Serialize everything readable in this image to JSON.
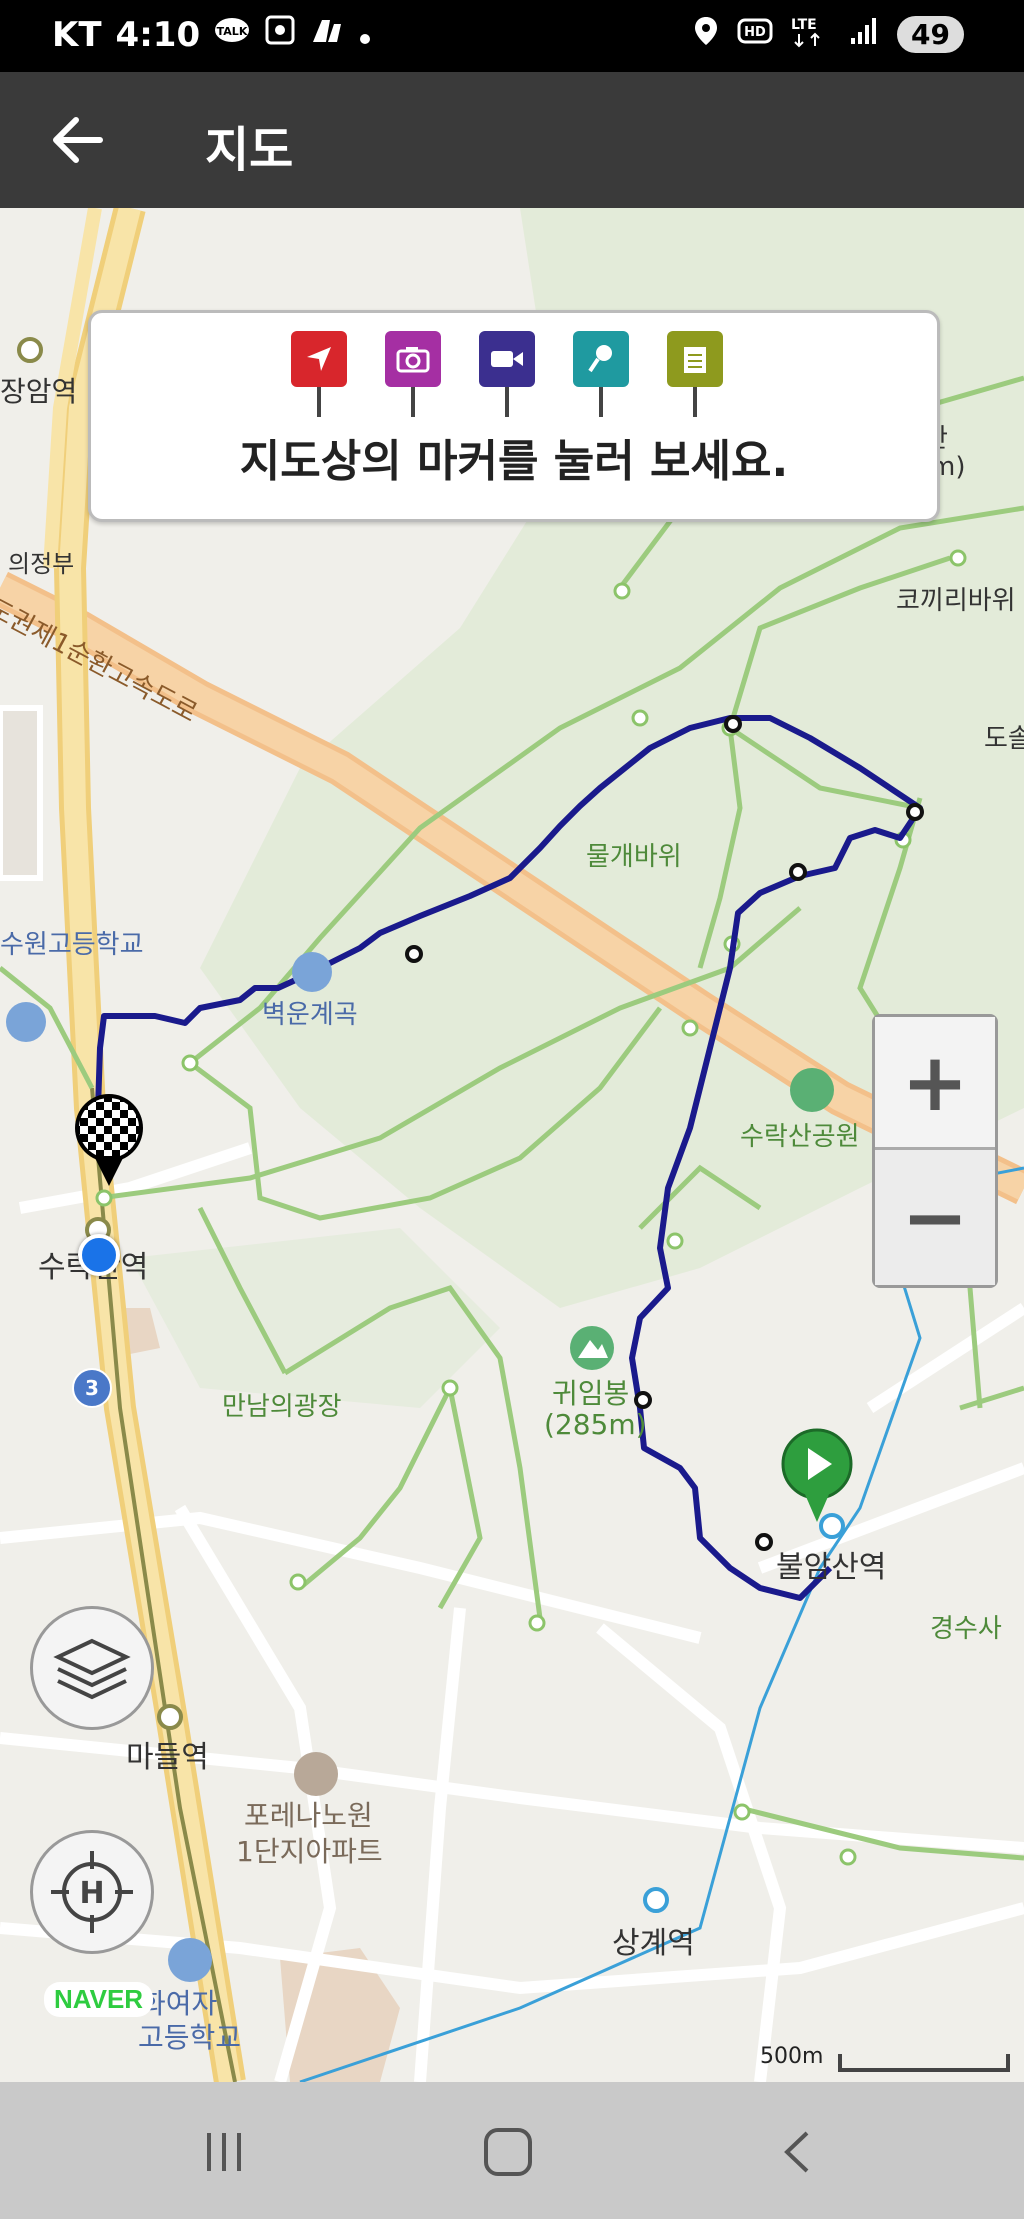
{
  "status": {
    "carrier": "KT",
    "time": "4:10",
    "network": "LTE",
    "hd": "HD",
    "battery": "49",
    "icons_left": [
      "talk-icon",
      "screenshot-icon",
      "shuttle-icon",
      "dot-icon"
    ],
    "icons_right": [
      "location-icon",
      "hd-icon",
      "lte-icon",
      "signal-icon",
      "battery-icon"
    ]
  },
  "header": {
    "title": "지도",
    "back_icon": "arrow-left-icon"
  },
  "marker_panel": {
    "markers": [
      {
        "name": "navigation",
        "icon": "location-arrow-icon",
        "color": "#d8262c"
      },
      {
        "name": "photo",
        "icon": "camera-icon",
        "color": "#a52fa3"
      },
      {
        "name": "video",
        "icon": "video-camera-icon",
        "color": "#3b2f8f"
      },
      {
        "name": "audio",
        "icon": "microphone-icon",
        "color": "#1f9aa0"
      },
      {
        "name": "memo",
        "icon": "notepad-icon",
        "color": "#8e9a1e"
      }
    ],
    "instruction": "지도상의 마커를 눌러 보세요."
  },
  "map_labels": {
    "jangam": "장암역",
    "uijeongbu": "의정부",
    "expressway": "도권제1순환고속도로",
    "suwon_high": "수원고등학교",
    "byeokun": "벽운계곡",
    "mulgae": "물개바위",
    "kokkiri": "코끼리바위",
    "dosol": "도솔",
    "peak_m": "m)",
    "peak_san": "산",
    "suraksan_park": "수락산공원",
    "gwiimbong": "귀임봉",
    "gwiimbong_alt": "(285m)",
    "suraksan_station": "수락산역",
    "route_3": "3",
    "mannam": "만남의광장",
    "bulamsan": "불암산역",
    "gyeongsusa": "경수사",
    "madeul": "마들역",
    "forena": "포레나노원",
    "forena2": "1단지아파트",
    "sanggye": "상계역",
    "girls_high": "화여자",
    "girls_high2": "고등학교"
  },
  "controls": {
    "zoom_in": "+",
    "zoom_out": "−",
    "layers_icon": "layers-icon",
    "locate_icon": "crosshair-h-icon",
    "naver": "NAVER",
    "scale_label": "500m"
  },
  "nav": {
    "recent_icon": "recent-apps-icon",
    "home_icon": "home-icon",
    "back_icon": "back-icon"
  },
  "colors": {
    "route": "#1a1a8c",
    "trail": "#8cc46a",
    "road_major": "#f5d88a",
    "start": "#2e9e3e"
  }
}
